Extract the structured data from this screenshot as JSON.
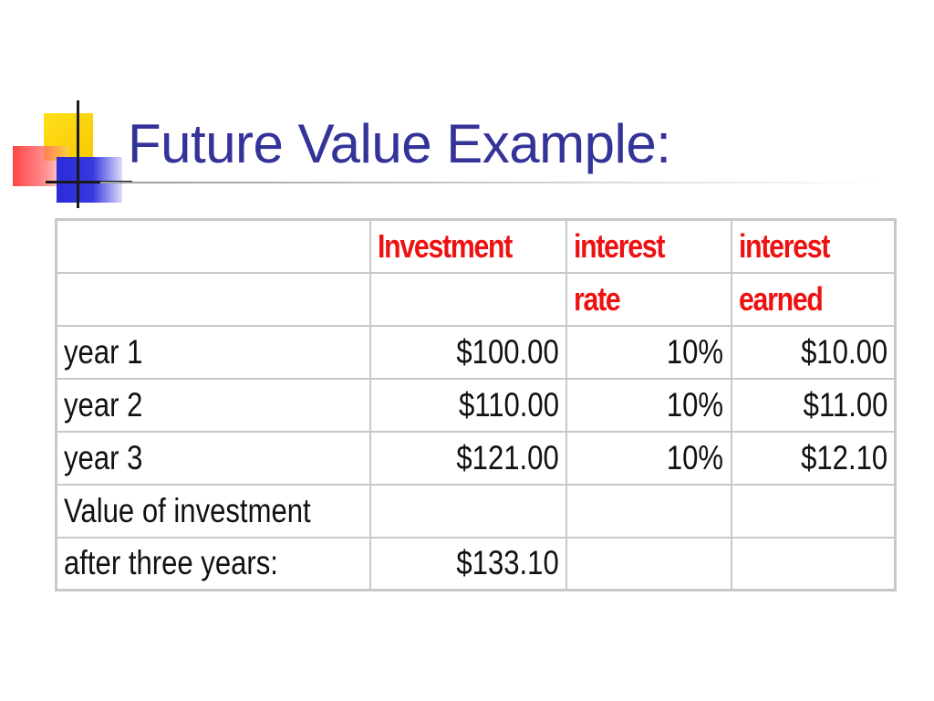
{
  "slide": {
    "title": "Future Value Example:"
  },
  "table": {
    "header_row_1": [
      "",
      "Investment",
      "interest",
      "interest"
    ],
    "header_row_2": [
      "",
      "",
      "rate",
      "earned"
    ],
    "rows": [
      {
        "label": "year 1",
        "investment": "$100.00",
        "rate": "10%",
        "earned": "$10.00"
      },
      {
        "label": "year 2",
        "investment": "$110.00",
        "rate": "10%",
        "earned": "$11.00"
      },
      {
        "label": "year 3",
        "investment": "$121.00",
        "rate": "10%",
        "earned": "$12.10"
      }
    ],
    "summary": {
      "label_line_1": "Value of investment",
      "label_line_2": "after three years:",
      "value": "$133.10"
    }
  },
  "colors": {
    "title": "#333399",
    "header_text": "#ee1111",
    "grid": "#c8c8c8"
  }
}
